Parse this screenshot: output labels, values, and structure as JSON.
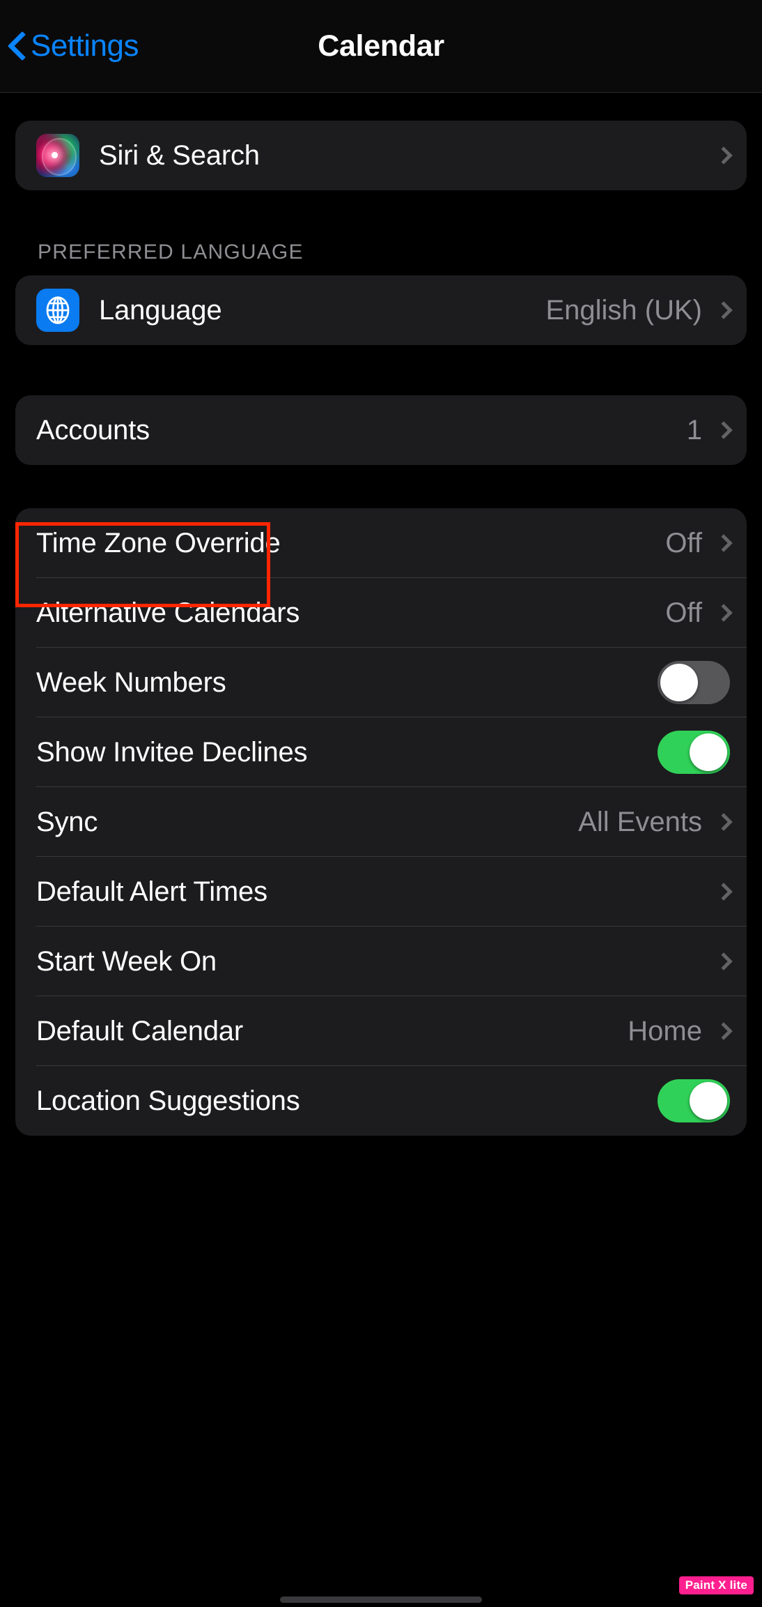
{
  "navbar": {
    "back_label": "Settings",
    "title": "Calendar",
    "back_icon": "chevron-left-icon",
    "accent_color": "#0a84ff"
  },
  "groups": {
    "siri": {
      "rows": [
        {
          "label": "Siri & Search",
          "icon": "siri-icon",
          "accessory": "chevron-right-icon"
        }
      ]
    },
    "language": {
      "header": "PREFERRED LANGUAGE",
      "rows": [
        {
          "label": "Language",
          "value": "English (UK)",
          "icon": "globe-icon",
          "accessory": "chevron-right-icon"
        }
      ]
    },
    "accounts": {
      "rows": [
        {
          "label": "Accounts",
          "value": "1",
          "accessory": "chevron-right-icon"
        }
      ]
    },
    "calendar_options": {
      "rows": [
        {
          "label": "Time Zone Override",
          "value": "Off",
          "accessory": "chevron-right-icon"
        },
        {
          "label": "Alternative Calendars",
          "value": "Off",
          "accessory": "chevron-right-icon"
        },
        {
          "label": "Week Numbers",
          "accessory": "toggle",
          "toggle_state": "off"
        },
        {
          "label": "Show Invitee Declines",
          "accessory": "toggle",
          "toggle_state": "on"
        },
        {
          "label": "Sync",
          "value": "All Events",
          "accessory": "chevron-right-icon"
        },
        {
          "label": "Default Alert Times",
          "value": "",
          "accessory": "chevron-right-icon"
        },
        {
          "label": "Start Week On",
          "value": "",
          "accessory": "chevron-right-icon"
        },
        {
          "label": "Default Calendar",
          "value": "Home",
          "accessory": "chevron-right-icon"
        },
        {
          "label": "Location Suggestions",
          "accessory": "toggle",
          "toggle_state": "on"
        }
      ]
    }
  },
  "annotation": {
    "target": "Accounts",
    "color": "#ff2600"
  },
  "watermark": {
    "text": "Paint X lite",
    "color": "#ff1f8f"
  },
  "colors": {
    "background": "#000000",
    "group_background": "#1c1c1e",
    "separator": "#38383a",
    "secondary_text": "#8e8e93",
    "toggle_on": "#30d158",
    "toggle_off": "#57575a"
  }
}
